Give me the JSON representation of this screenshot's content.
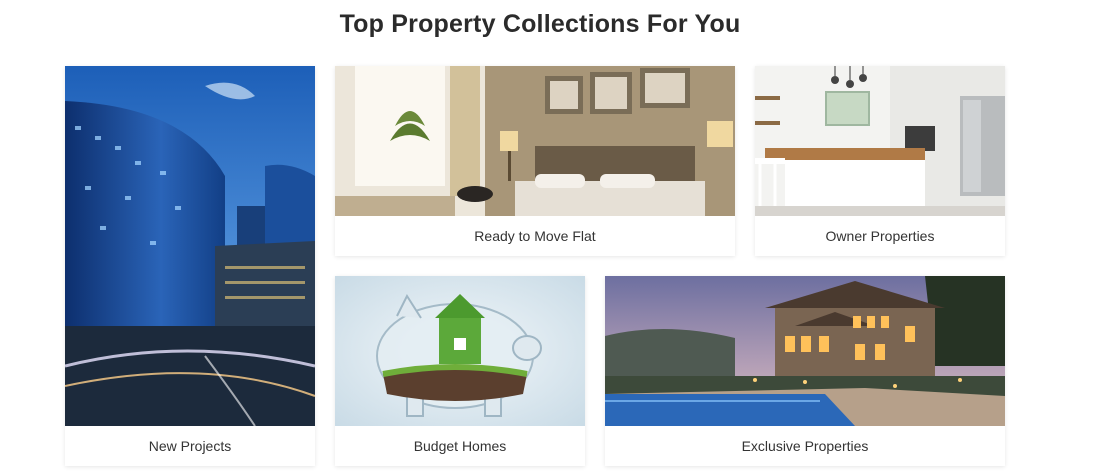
{
  "page": {
    "title": "Top Property Collections For You"
  },
  "collections": [
    {
      "label": "New Projects"
    },
    {
      "label": "Ready to Move Flat"
    },
    {
      "label": "Owner Properties"
    },
    {
      "label": "Budget Homes"
    },
    {
      "label": "Exclusive Properties"
    }
  ]
}
